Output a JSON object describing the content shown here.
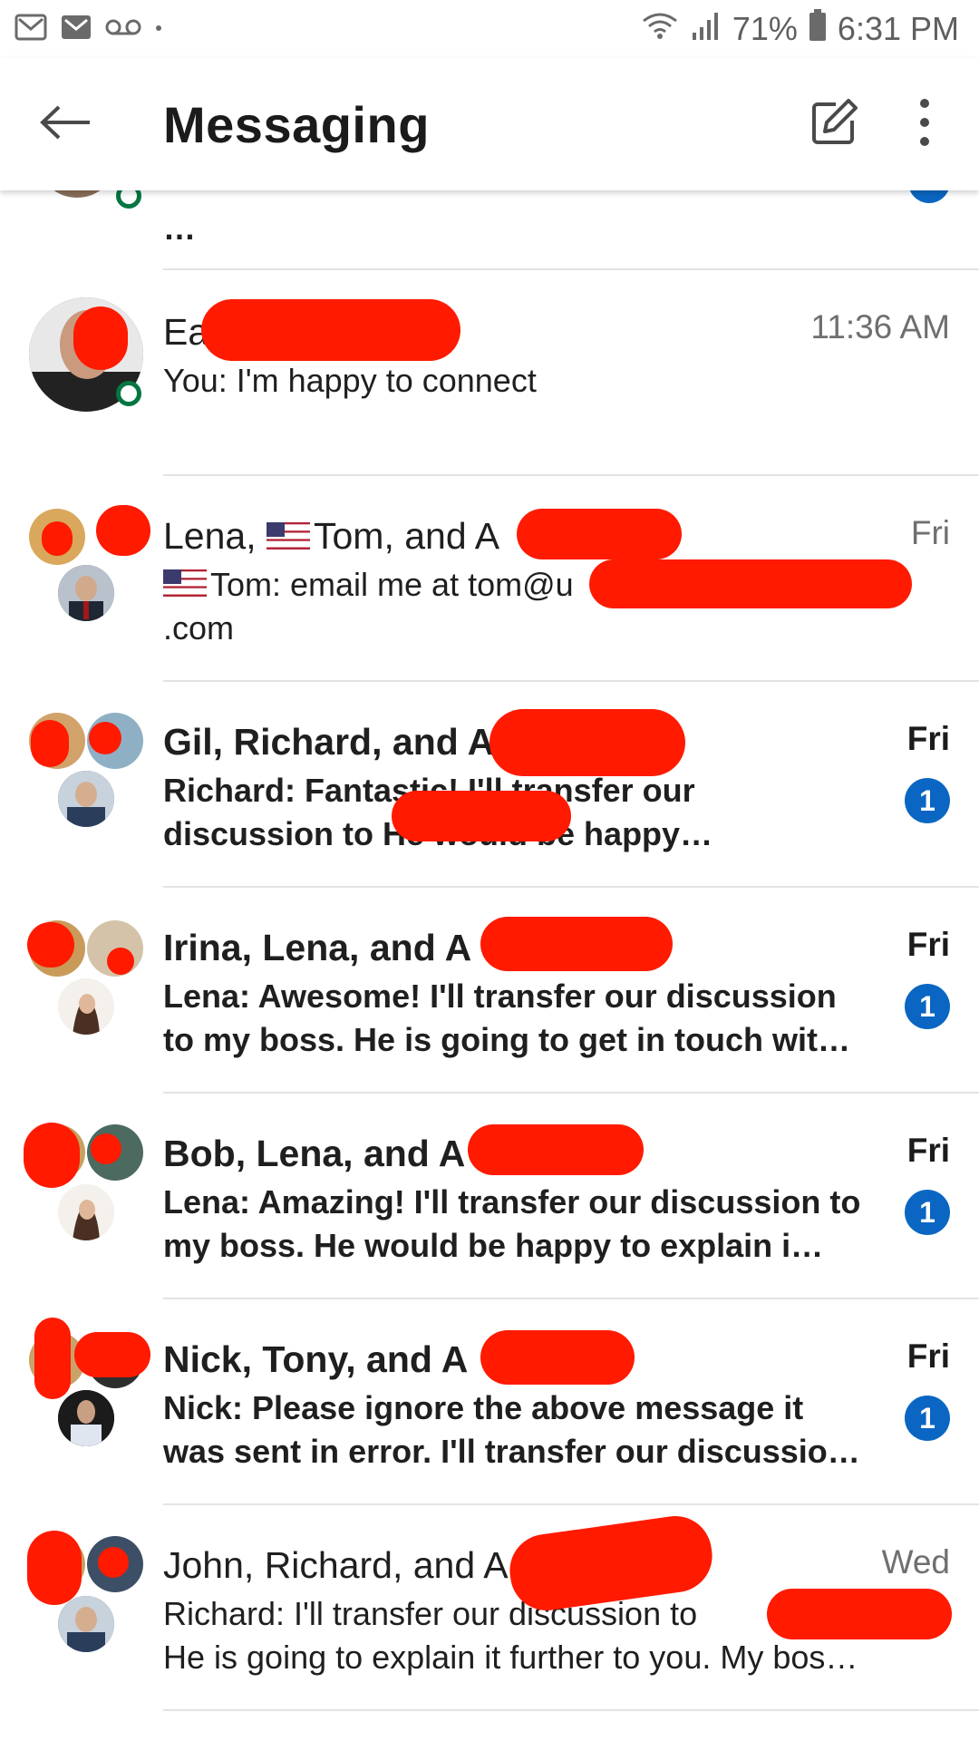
{
  "status_bar": {
    "battery": "71%",
    "time": "6:31 PM",
    "icons": [
      "gmail-icon",
      "gmail-icon",
      "voicemail-icon",
      "dot-icon",
      "wifi-icon",
      "signal-icon",
      "battery-icon"
    ]
  },
  "app_bar": {
    "title": "Messaging",
    "icons": [
      "back-arrow-icon",
      "compose-icon",
      "overflow-menu-icon"
    ]
  },
  "conversations": [
    {
      "name": "",
      "preview": "…",
      "time": "",
      "unread": true,
      "badge": ""
    },
    {
      "name": "Ea",
      "preview": "You: I'm happy to connect",
      "time": "11:36 AM",
      "unread": false,
      "badge": ""
    },
    {
      "name": "Lena, Tom, and A",
      "name_flag": true,
      "preview": "Tom: email me at tom@u",
      "preview_flag": true,
      "preview2": ".com",
      "time": "Fri",
      "unread": false,
      "badge": ""
    },
    {
      "name": "Gil, Richard, and A",
      "preview": "Richard: Fantastic! I'll transfer our discussion to",
      "preview_tail": "He would be happy…",
      "time": "Fri",
      "unread": true,
      "badge": "1"
    },
    {
      "name": "Irina, Lena, and A",
      "preview": "Lena: Awesome! I'll transfer our discussion to my boss. He is going to get in touch wit…",
      "time": "Fri",
      "unread": true,
      "badge": "1"
    },
    {
      "name": "Bob, Lena, and A",
      "preview": "Lena: Amazing! I'll transfer our discussion to my boss. He would be happy to explain i…",
      "time": "Fri",
      "unread": true,
      "badge": "1"
    },
    {
      "name": "Nick, Tony, and A",
      "preview": "Nick: Please ignore the above message it was sent in error. I'll transfer our discussio…",
      "time": "Fri",
      "unread": true,
      "badge": "1"
    },
    {
      "name": "John, Richard, and A",
      "preview": "Richard: I'll transfer our discussion to",
      "preview_line2": "He is going to explain it further to you. My bos…",
      "time": "Wed",
      "unread": false,
      "badge": ""
    }
  ],
  "colors": {
    "badge": "#0a66c2",
    "presence": "#057642",
    "redaction": "#ff1a00"
  }
}
